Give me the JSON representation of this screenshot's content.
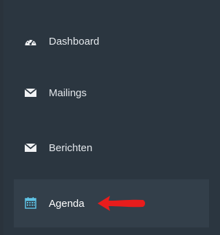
{
  "sidebar": {
    "items": [
      {
        "label": "Dashboard",
        "icon": "dashboard-icon"
      },
      {
        "label": "Mailings",
        "icon": "envelope-icon"
      },
      {
        "label": "Berichten",
        "icon": "envelope-icon"
      },
      {
        "label": "Agenda",
        "icon": "calendar-icon",
        "active": true
      }
    ]
  },
  "colors": {
    "background": "#2b3640",
    "active_background": "#333f4a",
    "text": "#e4e8ec",
    "icon": "#f0f2f4",
    "calendar_icon": "#5fc4e6",
    "arrow": "#e81c1c"
  },
  "annotation": {
    "arrow": "red-arrow"
  }
}
